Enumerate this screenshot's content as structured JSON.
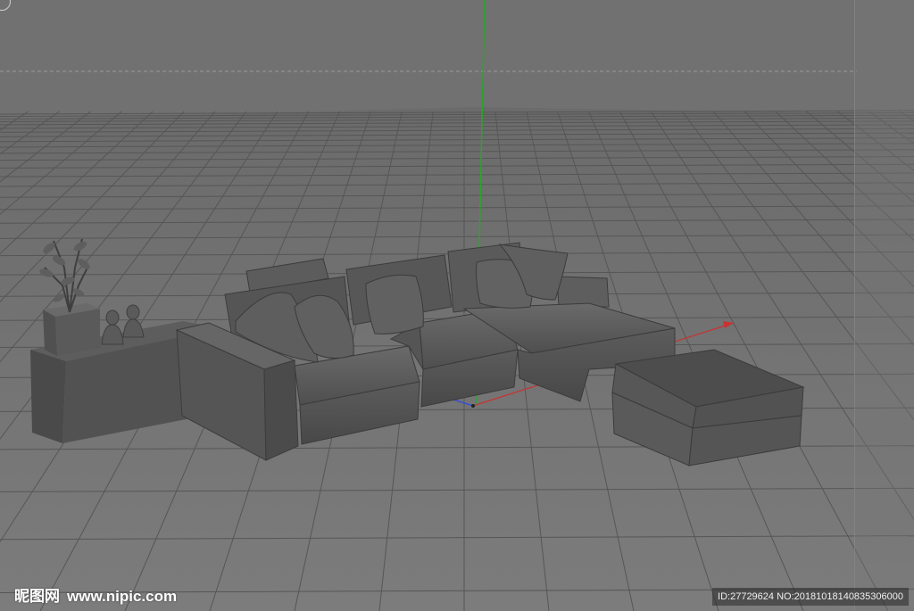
{
  "viewport": {
    "name": "3D perspective viewport",
    "background": "#6f6f6f",
    "floor_color": "#7a7a7a",
    "grid_color": "#5a5a5a",
    "y_axis_color": "#2aa52a",
    "x_axis_color": "#c83232",
    "z_axis_color": "#3a4fd0"
  },
  "watermark": {
    "brand": "昵图网",
    "site": "www.nipic.com",
    "id_text": "ID:27729624 NO:20181018140835306000"
  }
}
